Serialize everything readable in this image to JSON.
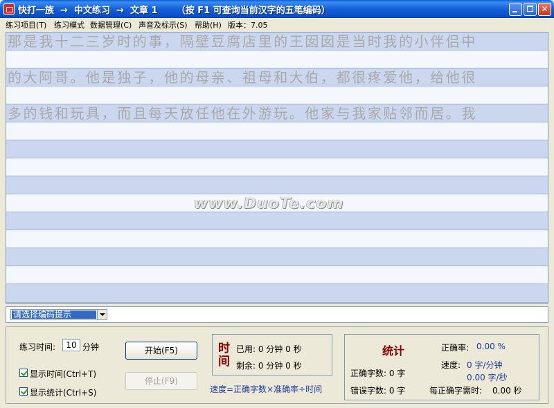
{
  "window": {
    "title": "快打一族  →  中文练习  →  文章 1      （按 F1 可查询当前汉字的五笔编码）"
  },
  "menu": [
    {
      "label": "练习项目(T)"
    },
    {
      "label": "练习模式"
    },
    {
      "label": "数据管理(C)"
    },
    {
      "label": "声音及标示(S)"
    },
    {
      "label": "帮助(H)"
    },
    {
      "label": "版本：7.05"
    }
  ],
  "practice": {
    "lines": [
      "那是我十二三岁时的事，隔壁豆腐店里的王囡囡是当时我的小伴侣中",
      "的大阿哥。他是独子，他的母亲、祖母和大伯，都很疼爱他，给他很",
      "多的钱和玩具，而且每天放任他在外游玩。他家与我家贴邻而居。我"
    ],
    "watermark": "www.DuoTe.com"
  },
  "hint": {
    "selected": "请选择编码提示"
  },
  "controls": {
    "time_label": "练习时间:",
    "time_value": "10",
    "time_unit": "分钟",
    "show_time": "显示时间(Ctrl+T)",
    "show_stats": "显示统计(Ctrl+S)",
    "start_button": "开始(F5)",
    "stop_button": "停止(F9)"
  },
  "time_panel": {
    "title_1": "时",
    "title_2": "间",
    "used": "已用: 0 分钟 0 秒",
    "remaining": "剩余: 0 分钟 0 秒",
    "formula": "速度=正确字数×准确率÷时间"
  },
  "stats": {
    "title": "统计",
    "correct_count": "正确字数: 0 字",
    "error_count": "错误字数: 0 字",
    "accuracy_label": "正确率:",
    "accuracy_value": "0.00 %",
    "speed_label": "速度:",
    "speed_per_min": "0 字/分钟",
    "speed_per_sec": "0.00 字/秒",
    "time_per_char_label": "每正确字需时:",
    "time_per_char_value": "0.00 秒"
  },
  "colors": {
    "title_bar": "#0a5fd8",
    "row_fill": "#cbd7ee",
    "input_row": "#f4f7fd",
    "ghost_text": "#a9a9a9",
    "accent_red": "#8b0000",
    "accent_blue": "#1d3c9a"
  }
}
